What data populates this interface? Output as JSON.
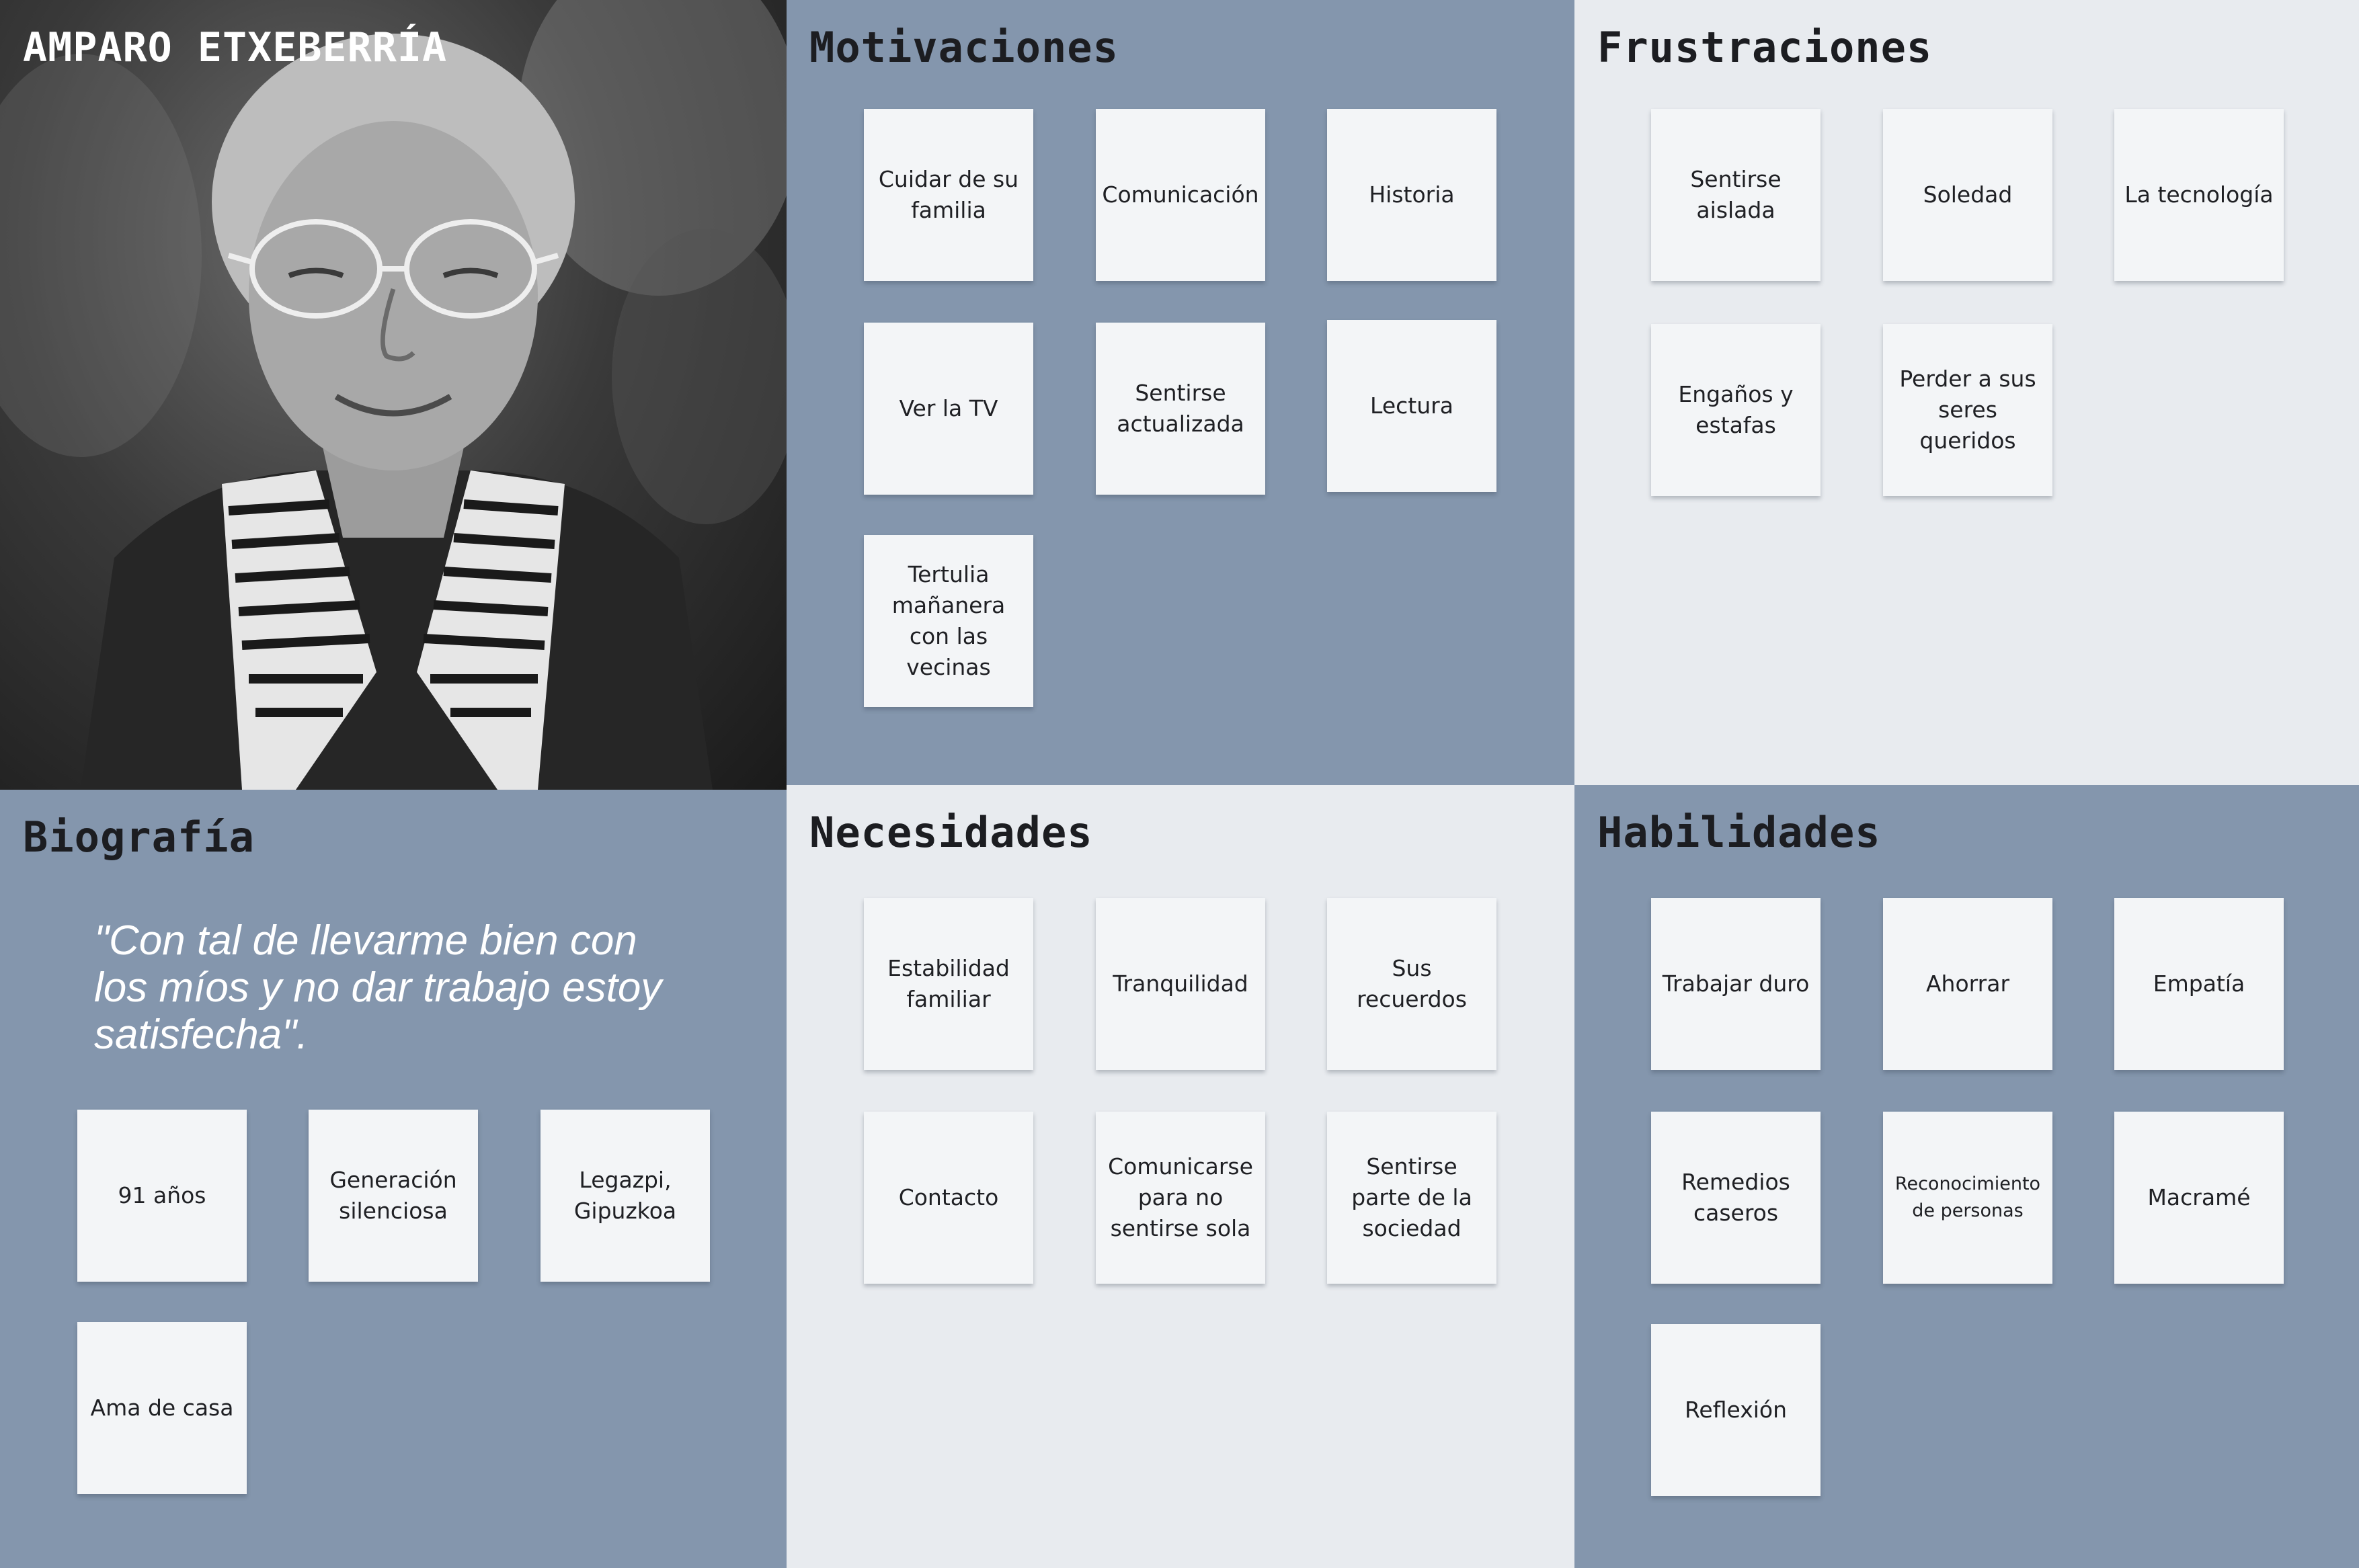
{
  "persona": {
    "name": "AMPARO ETXEBERRÍA",
    "photo_icon": "elderly-woman-portrait"
  },
  "motivaciones": {
    "title": "Motivaciones",
    "notes": [
      "Cuidar de su familia",
      "Comunicación",
      "Historia",
      "Ver la TV",
      "Sentirse actualizada",
      "Lectura",
      "Tertulia mañanera con las vecinas"
    ]
  },
  "frustraciones": {
    "title": "Frustraciones",
    "notes": [
      "Sentirse aislada",
      "Soledad",
      "La tecnología",
      "Engaños y estafas",
      "Perder a sus seres queridos"
    ]
  },
  "biografia": {
    "title": "Biografía",
    "quote": "\"Con tal de llevarme bien con los míos  y no dar trabajo estoy satisfecha\".",
    "notes": [
      "91 años",
      "Generación silenciosa",
      "Legazpi, Gipuzkoa",
      "Ama de casa"
    ]
  },
  "necesidades": {
    "title": "Necesidades",
    "notes": [
      "Estabilidad familiar",
      "Tranquilidad",
      "Sus recuerdos",
      "Contacto",
      "Comunicarse para no sentirse sola",
      "Sentirse parte de la sociedad"
    ]
  },
  "habilidades": {
    "title": "Habilidades",
    "notes": [
      "Trabajar duro",
      "Ahorrar",
      "Empatía",
      "Remedios caseros",
      "Reconocimiento de personas",
      "Macramé",
      "Reflexión"
    ]
  },
  "colors": {
    "slate": "#8496ad",
    "light": "#e8ebef",
    "note": "#f3f5f7"
  }
}
